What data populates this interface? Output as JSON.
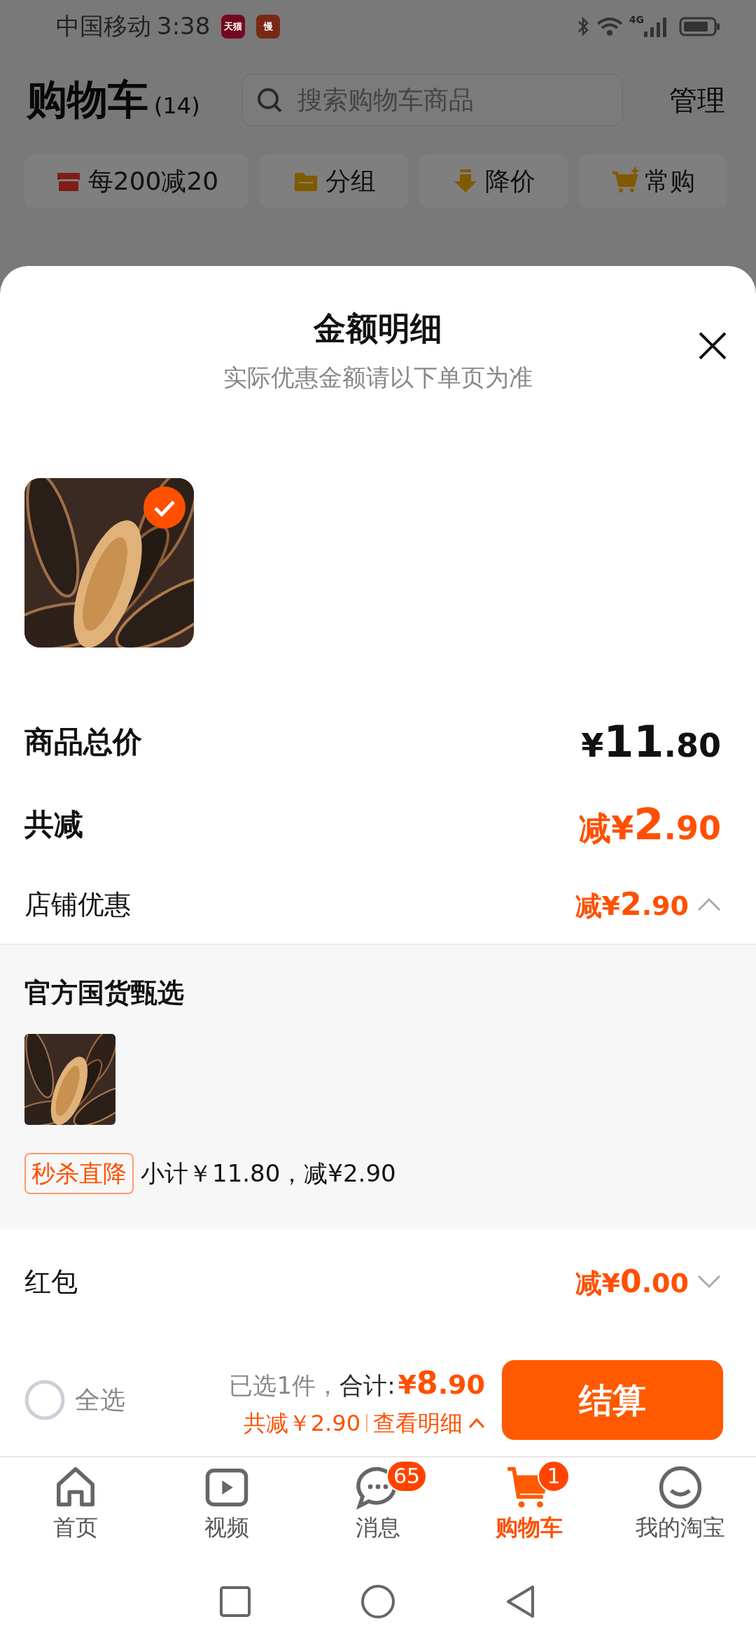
{
  "status_bar": {
    "carrier": "中国移动",
    "time": "3:38",
    "app_icons": [
      {
        "label": "天猫",
        "color": "#740820"
      },
      {
        "label": "慢",
        "color": "#782915"
      }
    ],
    "network": "4G"
  },
  "header": {
    "title": "购物车",
    "count": "(14)",
    "search": {
      "placeholder": "搜索购物车商品"
    },
    "manage": "管理"
  },
  "chips": [
    {
      "kind": "store",
      "label": "每200减20"
    },
    {
      "kind": "folder",
      "label": "分组"
    },
    {
      "kind": "price-drop",
      "label": "降价"
    },
    {
      "kind": "cart-plus",
      "label": "常购"
    }
  ],
  "sheet": {
    "title": "金额明细",
    "subtitle": "实际优惠金额请以下单页为准",
    "products": [
      {
        "kind": "picture",
        "selected": true
      }
    ],
    "rows": [
      {
        "kind": "total",
        "label": "商品总价",
        "prefix": "¥",
        "amount": "11",
        "cents": ".80"
      },
      {
        "kind": "discount",
        "label": "共减",
        "prefix": "减¥",
        "amount": "2",
        "cents": ".90"
      },
      {
        "kind": "detail",
        "label": "店铺优惠",
        "prefix": "减¥",
        "amount": "2",
        "cents": ".90",
        "expanded": true,
        "shop": "官方国货甄选",
        "items": [
          {
            "kind": "picture"
          }
        ],
        "tag": "秒杀直降",
        "note": "小计￥11.80，减¥2.90"
      },
      {
        "kind": "detail",
        "label": "红包",
        "prefix": "减¥",
        "amount": "0",
        "cents": ".00",
        "expanded": false
      }
    ]
  },
  "bottom_bar": {
    "select_all": {
      "label": "全选",
      "checked": false
    },
    "selected_count": "已选1件，",
    "total_label": "合计:",
    "total": {
      "prefix": "¥",
      "amount": "8",
      "cents": ".90"
    },
    "savings": "共减￥2.90",
    "detail_link": "查看明细",
    "checkout": "结算"
  },
  "tabs": [
    {
      "kind": "home",
      "label": "首页",
      "selected": false
    },
    {
      "kind": "video",
      "label": "视频",
      "selected": false
    },
    {
      "kind": "message",
      "label": "消息",
      "selected": false,
      "badge": "65"
    },
    {
      "kind": "cart",
      "label": "购物车",
      "selected": true,
      "badge": "1"
    },
    {
      "kind": "profile",
      "label": "我的淘宝",
      "selected": false
    }
  ]
}
